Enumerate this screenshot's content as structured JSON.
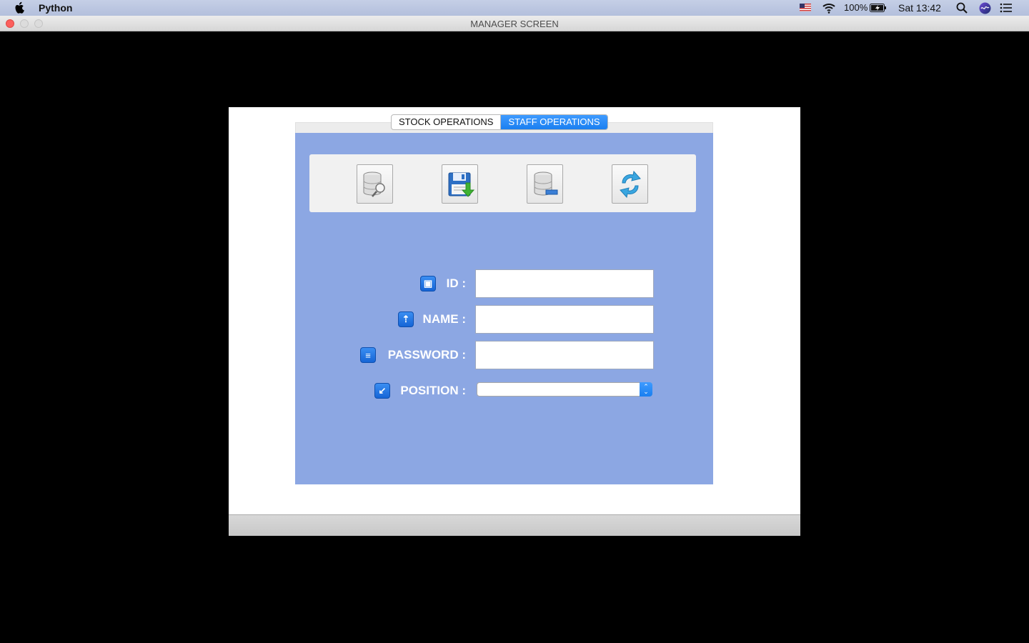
{
  "menubar": {
    "app_name": "Python",
    "battery": "100%",
    "clock": "Sat 13:42",
    "icons": [
      "apple-icon",
      "flag-us-icon",
      "wifi-icon",
      "battery-icon",
      "search-icon",
      "siri-icon",
      "control-center-icon"
    ]
  },
  "window": {
    "title": "MANAGER SCREEN"
  },
  "tabs": [
    {
      "label": "STOCK OPERATIONS",
      "active": false
    },
    {
      "label": "STAFF OPERATIONS",
      "active": true
    }
  ],
  "toolbar": {
    "buttons": [
      {
        "name": "database-search",
        "icon": "database-search-icon"
      },
      {
        "name": "save",
        "icon": "floppy-save-icon"
      },
      {
        "name": "database-delete",
        "icon": "database-remove-icon"
      },
      {
        "name": "refresh",
        "icon": "refresh-icon"
      }
    ]
  },
  "form": {
    "id_label": "ID :",
    "id_value": "",
    "name_label": "NAME :",
    "name_value": "",
    "password_label": "PASSWORD :",
    "password_value": "",
    "position_label": "POSITION :",
    "position_value": ""
  },
  "colors": {
    "panel_bg": "#8ca7e3",
    "accent": "#1a7ff0"
  }
}
